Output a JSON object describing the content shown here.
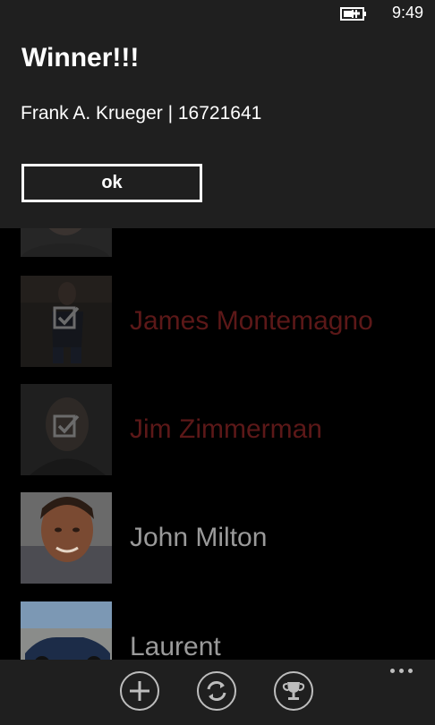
{
  "status_bar": {
    "time": "9:49",
    "battery_icon": "battery-charging-icon"
  },
  "dialog": {
    "title": "Winner!!!",
    "message": "Frank A. Krueger | 16721641",
    "ok_label": "ok"
  },
  "contacts": [
    {
      "name": "",
      "selected": false,
      "avatar": "person-photo"
    },
    {
      "name": "James Montemagno",
      "selected": true,
      "avatar": "person-photo"
    },
    {
      "name": "Jim Zimmerman",
      "selected": true,
      "avatar": "person-photo"
    },
    {
      "name": "John Milton",
      "selected": false,
      "avatar": "person-photo"
    },
    {
      "name": "Laurent",
      "selected": false,
      "avatar": "car-photo"
    }
  ],
  "app_bar": {
    "buttons": [
      {
        "icon": "add-icon"
      },
      {
        "icon": "refresh-icon"
      },
      {
        "icon": "trophy-icon"
      }
    ],
    "more_icon": "ellipsis-icon"
  },
  "colors": {
    "selected_name": "#5c1818",
    "normal_name": "#9a9a9a",
    "dialog_bg": "#1f1f1f"
  }
}
